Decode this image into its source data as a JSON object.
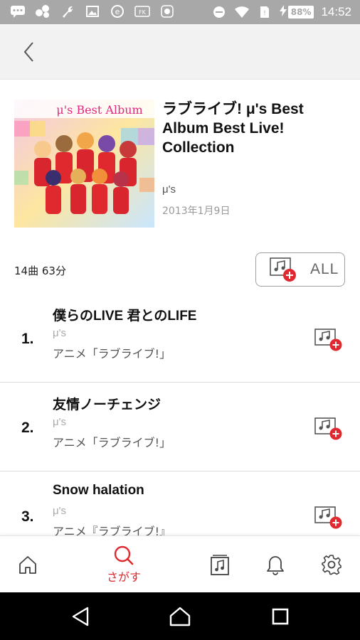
{
  "status_bar": {
    "icons": [
      "chat-icon",
      "dots-cluster-icon",
      "wrench-icon",
      "image-icon",
      "sync-icon",
      "fk-icon",
      "app-icon",
      "dnd-icon",
      "wifi-icon",
      "sim-icon",
      "charging-icon"
    ],
    "battery": "88%",
    "time": "14:52"
  },
  "header": {
    "back_icon": "chevron-left-icon"
  },
  "album": {
    "title": "ラブライブ! μ's Best Album Best Live! Collection",
    "artist": "μ's",
    "release_date": "2013年1月9日",
    "art_caption": "μ's Best Album",
    "summary": "14曲  63分",
    "add_all_label": "ALL"
  },
  "tracks": [
    {
      "number": "1.",
      "title": "僕らのLIVE 君とのLIFE",
      "artist": "μ's",
      "album": "アニメ「ラブライブ!」"
    },
    {
      "number": "2.",
      "title": "友情ノーチェンジ",
      "artist": "μ's",
      "album": "アニメ「ラブライブ!」"
    },
    {
      "number": "3.",
      "title": "Snow halation",
      "artist": "μ's",
      "album": "アニメ『ラブライブ!』"
    }
  ],
  "bottom_nav": {
    "items": [
      {
        "icon": "home-icon",
        "label": ""
      },
      {
        "icon": "search-icon",
        "label": "さがす",
        "active": true
      },
      {
        "icon": "playlist-icon",
        "label": ""
      },
      {
        "icon": "bell-icon",
        "label": ""
      },
      {
        "icon": "gear-icon",
        "label": ""
      }
    ]
  },
  "colors": {
    "accent": "#e0282f",
    "status_bar": "#a8a8a8",
    "header_bg": "#f2f2f2"
  }
}
